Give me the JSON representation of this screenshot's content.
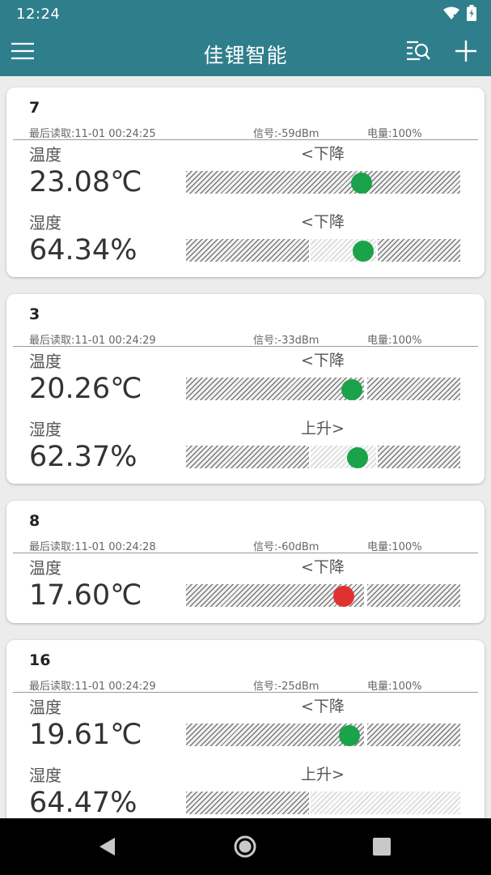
{
  "status_bar": {
    "time": "12:24",
    "icons": [
      "wifi-icon",
      "battery-icon"
    ]
  },
  "app_bar": {
    "title": "佳锂智能",
    "icons": [
      "menu-icon",
      "search-list-icon",
      "add-icon"
    ]
  },
  "colors": {
    "primary": "#2f7e8b",
    "dot_green": "#1aa34a",
    "dot_red": "#e03131"
  },
  "devices": [
    {
      "id": "7",
      "last_read": "最后读取:11-01 00:24:25",
      "signal": "信号:-59dBm",
      "battery": "电量:100%",
      "readings": [
        {
          "label": "温度",
          "trend": "<下降",
          "value": "23.08℃",
          "level": 0.64,
          "status": "green"
        },
        {
          "label": "湿度",
          "trend": "<下降",
          "value": "64.34%",
          "level": 0.645,
          "status": "green"
        }
      ]
    },
    {
      "id": "3",
      "last_read": "最后读取:11-01 00:24:29",
      "signal": "信号:-33dBm",
      "battery": "电量:100%",
      "readings": [
        {
          "label": "温度",
          "trend": "<下降",
          "value": "20.26℃",
          "level": 0.605,
          "status": "green"
        },
        {
          "label": "湿度",
          "trend": "上升>",
          "value": "62.37%",
          "level": 0.625,
          "status": "green"
        }
      ]
    },
    {
      "id": "8",
      "last_read": "最后读取:11-01 00:24:28",
      "signal": "信号:-60dBm",
      "battery": "电量:100%",
      "readings": [
        {
          "label": "温度",
          "trend": "<下降",
          "value": "17.60℃",
          "level": 0.575,
          "status": "red"
        }
      ]
    },
    {
      "id": "16",
      "last_read": "最后读取:11-01 00:24:29",
      "signal": "信号:-25dBm",
      "battery": "电量:100%",
      "readings": [
        {
          "label": "温度",
          "trend": "<下降",
          "value": "19.61℃",
          "level": 0.595,
          "status": "green"
        },
        {
          "label": "湿度",
          "trend": "上升>",
          "value": "64.47%",
          "level": null,
          "status": "none"
        }
      ]
    }
  ],
  "nav_bar": {
    "icons": [
      "back-icon",
      "home-icon",
      "recents-icon"
    ]
  }
}
